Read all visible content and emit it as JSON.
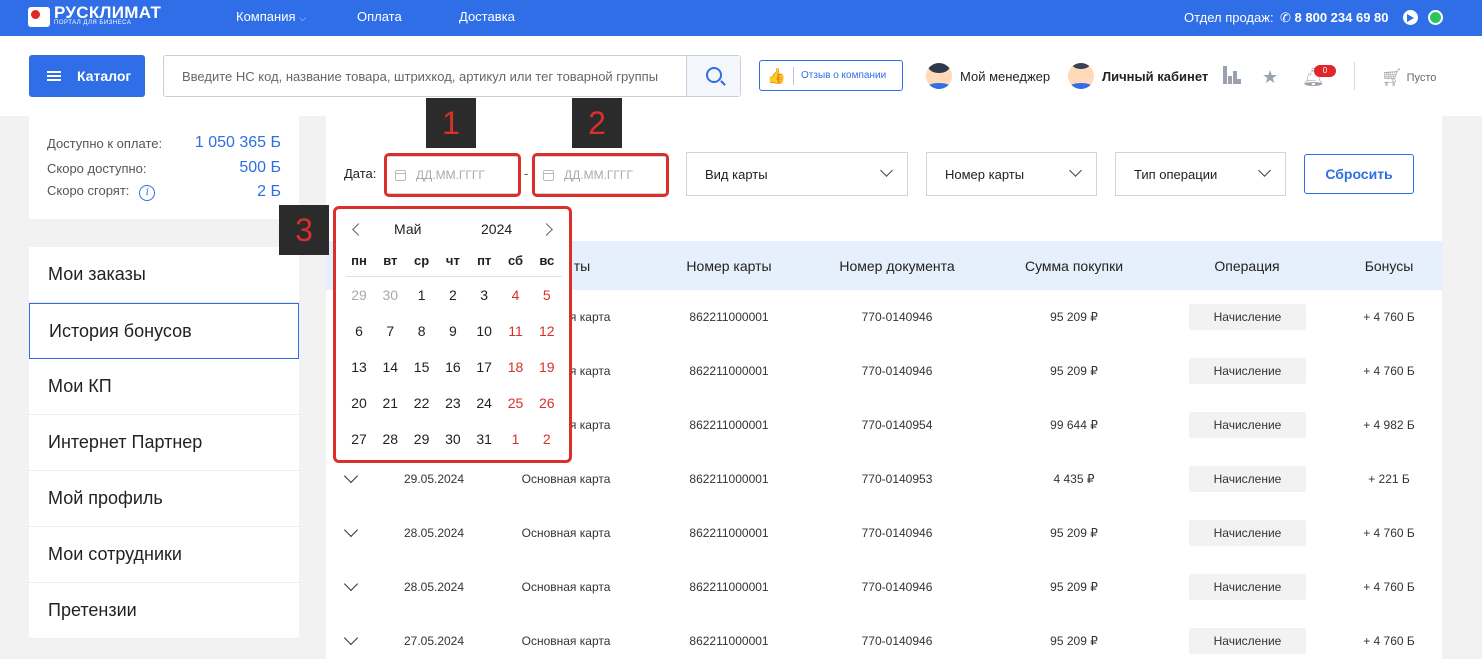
{
  "topbar": {
    "logo_text": "РУСКЛИМАТ",
    "logo_sub": "ПОРТАЛ ДЛЯ БИЗНЕСА",
    "nav": [
      "Компания",
      "Оплата",
      "Доставка"
    ],
    "sales_label": "Отдел продаж:",
    "phone": "8 800 234 69 80"
  },
  "header": {
    "catalog_label": "Каталог",
    "search_placeholder": "Введите НС код, название товара, штрихкод, артикул или тег товарной группы",
    "review_label": "Отзыв о компании",
    "manager_label": "Мой менеджер",
    "account_label": "Личный кабинет",
    "notifications_count": "0",
    "cart_label": "Пусто"
  },
  "balance": {
    "available_label": "Доступно к оплате:",
    "available_value": "1 050 365 Б",
    "soon_label": "Скоро доступно:",
    "soon_value": "500 Б",
    "expire_label": "Скоро сгорят:",
    "expire_value": "2 Б"
  },
  "menu": [
    "Мои заказы",
    "История бонусов",
    "Мои КП",
    "Интернет Партнер",
    "Мой профиль",
    "Мои сотрудники",
    "Претензии"
  ],
  "filters": {
    "date_label": "Дата:",
    "date_from_placeholder": "ДД.ММ.ГГГГ",
    "date_to_placeholder": "ДД.ММ.ГГГГ",
    "dash": "-",
    "card_type": "Вид карты",
    "card_number": "Номер карты",
    "operation_type": "Тип операции",
    "reset_label": "Сбросить"
  },
  "table": {
    "headers": [
      "Номер карты",
      "Номер документа",
      "Сумма покупки",
      "Операция",
      "Бонусы"
    ],
    "partial_header": "ты",
    "rows": [
      {
        "date": "",
        "card": "Основная карта",
        "card_no": "862211000001",
        "doc": "770-0140946",
        "sum": "95 209 ₽",
        "op": "Начисление",
        "bonus": "+ 4 760 Б"
      },
      {
        "date": "",
        "card": "Основная карта",
        "card_no": "862211000001",
        "doc": "770-0140946",
        "sum": "95 209 ₽",
        "op": "Начисление",
        "bonus": "+ 4 760 Б"
      },
      {
        "date": "",
        "card": "Основная карта",
        "card_no": "862211000001",
        "doc": "770-0140954",
        "sum": "99 644 ₽",
        "op": "Начисление",
        "bonus": "+ 4 982 Б"
      },
      {
        "date": "29.05.2024",
        "card": "Основная карта",
        "card_no": "862211000001",
        "doc": "770-0140953",
        "sum": "4 435 ₽",
        "op": "Начисление",
        "bonus": "+ 221 Б"
      },
      {
        "date": "28.05.2024",
        "card": "Основная карта",
        "card_no": "862211000001",
        "doc": "770-0140946",
        "sum": "95 209 ₽",
        "op": "Начисление",
        "bonus": "+ 4 760 Б"
      },
      {
        "date": "28.05.2024",
        "card": "Основная карта",
        "card_no": "862211000001",
        "doc": "770-0140946",
        "sum": "95 209 ₽",
        "op": "Начисление",
        "bonus": "+ 4 760 Б"
      },
      {
        "date": "27.05.2024",
        "card": "Основная карта",
        "card_no": "862211000001",
        "doc": "770-0140946",
        "sum": "95 209 ₽",
        "op": "Начисление",
        "bonus": "+ 4 760 Б"
      }
    ]
  },
  "calendar": {
    "month": "Май",
    "year": "2024",
    "weekdays": [
      "пн",
      "вт",
      "ср",
      "чт",
      "пт",
      "сб",
      "вс"
    ],
    "weeks": [
      [
        "29",
        "30",
        "1",
        "2",
        "3",
        "4",
        "5"
      ],
      [
        "6",
        "7",
        "8",
        "9",
        "10",
        "11",
        "12"
      ],
      [
        "13",
        "14",
        "15",
        "16",
        "17",
        "18",
        "19"
      ],
      [
        "20",
        "21",
        "22",
        "23",
        "24",
        "25",
        "26"
      ],
      [
        "27",
        "28",
        "29",
        "30",
        "31",
        "1",
        "2"
      ]
    ],
    "outside_month": [
      [
        0,
        0
      ],
      [
        0,
        1
      ],
      [
        4,
        5
      ],
      [
        4,
        6
      ]
    ]
  },
  "callouts": [
    "1",
    "2",
    "3"
  ],
  "colors": {
    "brand": "#2f6ee6",
    "highlight": "#d9302b",
    "weekend": "#d9302b",
    "muted": "#aaaaaa"
  }
}
